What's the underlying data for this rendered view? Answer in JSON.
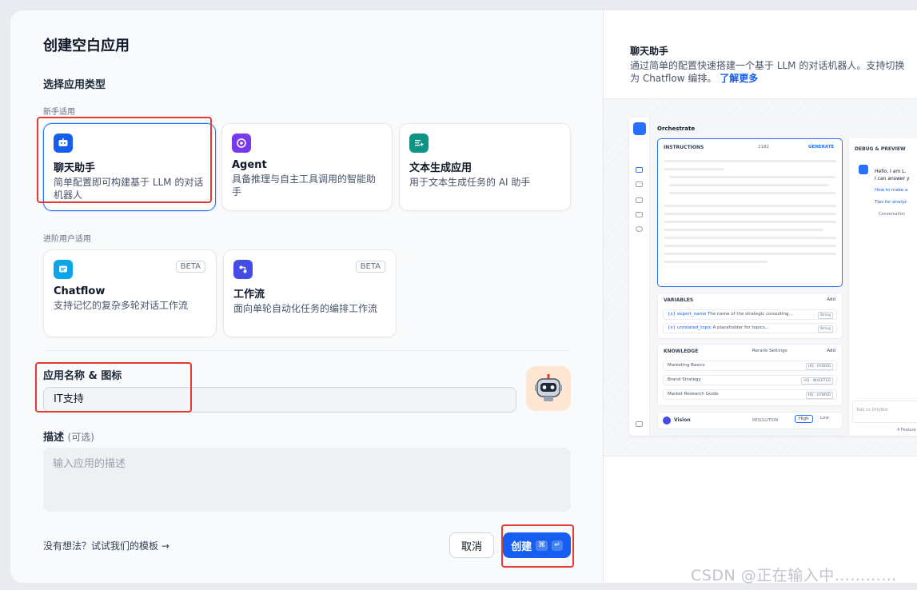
{
  "dialog": {
    "title": "创建空白应用",
    "section_title": "选择应用类型",
    "beginner_label": "新手适用",
    "advanced_label": "进阶用户适用",
    "beta_label": "BETA"
  },
  "app_types": [
    {
      "key": "chat",
      "name": "聊天助手",
      "desc": "简单配置即可构建基于 LLM 的对话机器人",
      "icon": "chat-bot-icon",
      "color": "#155eef",
      "selected": true
    },
    {
      "key": "agent",
      "name": "Agent",
      "desc": "具备推理与自主工具调用的智能助手",
      "icon": "agent-icon",
      "color": "#7839ee",
      "selected": false
    },
    {
      "key": "completion",
      "name": "文本生成应用",
      "desc": "用于文本生成任务的 AI 助手",
      "icon": "text-generate-icon",
      "color": "#0e9384",
      "selected": false
    },
    {
      "key": "chatflow",
      "name": "Chatflow",
      "desc": "支持记忆的复杂多轮对话工作流",
      "icon": "chatflow-icon",
      "color": "#0ba5ec",
      "selected": false,
      "beta": true
    },
    {
      "key": "workflow",
      "name": "工作流",
      "desc": "面向单轮自动化任务的编排工作流",
      "icon": "workflow-icon",
      "color": "#444ce7",
      "selected": false,
      "beta": true
    }
  ],
  "form": {
    "name_label": "应用名称 & 图标",
    "name_value": "IT支持",
    "avatar_icon": "robot-avatar-icon",
    "desc_label": "描述",
    "desc_optional": "(可选)",
    "desc_placeholder": "输入应用的描述"
  },
  "footer": {
    "template_link": "没有想法？试试我们的模板",
    "template_arrow": "→",
    "cancel_label": "取消",
    "create_label": "创建",
    "create_kbd_1": "⌘",
    "create_kbd_2": "↵"
  },
  "preview": {
    "title": "聊天助手",
    "desc": "通过简单的配置快速搭建一个基于 LLM 的对话机器人。支持切换为 Chatflow 编排。",
    "learn_more": "了解更多",
    "shot": {
      "orchestrate": "Orchestrate",
      "instructions": "INSTRUCTIONS",
      "token_count": "2182",
      "generate": "GENERATE",
      "variables": "VARIABLES",
      "add": "Add",
      "var_rows": [
        {
          "name": "{x} expert_name",
          "hint": "The name of the strategic consulting...",
          "type": "String"
        },
        {
          "name": "{x} unrelated_topic",
          "hint": "A placeholder for topics...",
          "type": "String",
          "required": "REQUIRED"
        }
      ],
      "knowledge": "KNOWLEDGE",
      "rerank": "Rerank Settings",
      "knowledge_rows": [
        {
          "name": "Marketing Basics",
          "tag": "HQ · HYBRID"
        },
        {
          "name": "Brand Strategy",
          "tag": "HQ · INVERTED"
        },
        {
          "name": "Market Research Guide",
          "tag": "HQ · HYBRID"
        }
      ],
      "vision": "Vision",
      "resolution": "RESOLUTION",
      "high": "High",
      "low": "Low",
      "debug": "DEBUG & PREVIEW",
      "bot_greeting_1": "Hello, I am L.",
      "bot_greeting_2": "I can answer y",
      "suggestion_1": "How to make a",
      "suggestion_2": "Tips for analyz",
      "conversation": "Conversation",
      "talk_placeholder": "Talk to DifyBot",
      "features": "4 Feature"
    }
  },
  "watermark": "CSDN @正在输入中…………"
}
